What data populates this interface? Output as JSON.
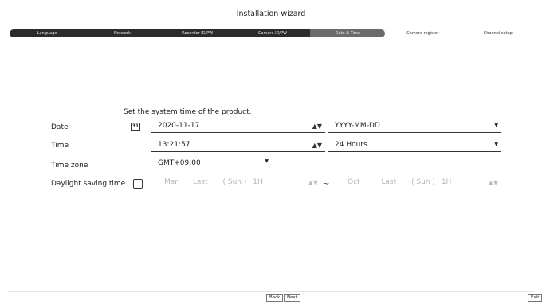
{
  "title": "Installation wizard",
  "steps": [
    {
      "label": "Language",
      "state": "done"
    },
    {
      "label": "Network",
      "state": "done"
    },
    {
      "label": "Recorder ID/PW",
      "state": "done"
    },
    {
      "label": "Camera ID/PW",
      "state": "done"
    },
    {
      "label": "Date & Time",
      "state": "active"
    },
    {
      "label": "Camera register",
      "state": "todo"
    },
    {
      "label": "Channel setup",
      "state": "todo"
    }
  ],
  "intro": "Set the system time of the product.",
  "date": {
    "label": "Date",
    "calendar_icon_text": "31",
    "value": "2020-11-17",
    "format": "YYYY-MM-DD"
  },
  "time": {
    "label": "Time",
    "value": "13:21:57",
    "format": "24 Hours"
  },
  "timezone": {
    "label": "Time zone",
    "value": "GMT+09:00"
  },
  "dst": {
    "label": "Daylight saving time",
    "checked": false,
    "start": {
      "month": "Mar",
      "week": "Last",
      "day": "( Sun )",
      "hour": "1H"
    },
    "separator": "~",
    "end": {
      "month": "Oct",
      "week": "Last",
      "day": "( Sun )",
      "hour": "1H"
    }
  },
  "buttons": {
    "back": "Back",
    "next": "Next",
    "exit": "Exit"
  },
  "icons": {
    "spinner": "up-down-spinner-icon",
    "dropdown": "triangle-down-icon",
    "calendar": "calendar-icon"
  }
}
